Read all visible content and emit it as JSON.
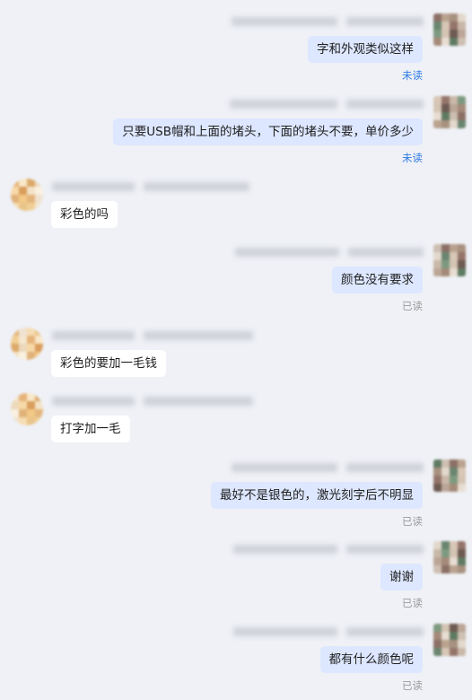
{
  "chat": {
    "messages": [
      {
        "direction": "out",
        "text": "字和外观类似这样",
        "status": "未读",
        "status_kind": "unread"
      },
      {
        "direction": "out",
        "text": "只要USB帽和上面的堵头，下面的堵头不要，单价多少",
        "status": "未读",
        "status_kind": "unread"
      },
      {
        "direction": "in",
        "text": "彩色的吗"
      },
      {
        "direction": "out",
        "text": "颜色没有要求",
        "status": "已读",
        "status_kind": "read"
      },
      {
        "direction": "in",
        "text": "彩色的要加一毛钱"
      },
      {
        "direction": "in",
        "text": "打字加一毛"
      },
      {
        "direction": "out",
        "text": "最好不是银色的，激光刻字后不明显",
        "status": "已读",
        "status_kind": "read"
      },
      {
        "direction": "out",
        "text": "谢谢",
        "status": "已读",
        "status_kind": "read"
      },
      {
        "direction": "out",
        "text": "都有什么颜色呢",
        "status": "已读",
        "status_kind": "read"
      }
    ]
  },
  "colors": {
    "background": "#eff1f6",
    "outgoing_bubble": "#dde7ff",
    "incoming_bubble": "#ffffff",
    "unread_status": "#2f7ae5",
    "read_status": "#9a9a9a"
  }
}
